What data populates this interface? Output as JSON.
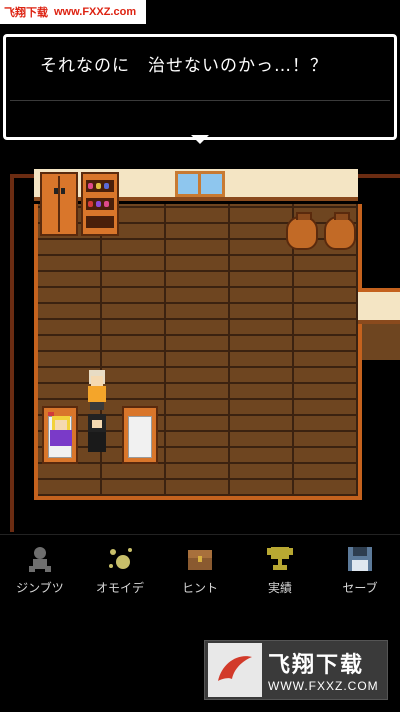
{
  "watermark_top": {
    "cn": "飞翔下载",
    "url": "www.FXXZ.com"
  },
  "dialog": {
    "text": "それなのに　治せないのかっ…！？"
  },
  "menu": {
    "items": [
      {
        "label": "ジンブツ",
        "icon": "person-silhouette-icon"
      },
      {
        "label": "オモイデ",
        "icon": "sparkle-memory-icon"
      },
      {
        "label": "ヒント",
        "icon": "treasure-chest-icon"
      },
      {
        "label": "実績",
        "icon": "trophy-icon"
      },
      {
        "label": "セーブ",
        "icon": "floppy-disk-icon"
      }
    ]
  },
  "watermark_bottom": {
    "cn": "飞翔下载",
    "url": "WWW.FXXZ.COM"
  }
}
